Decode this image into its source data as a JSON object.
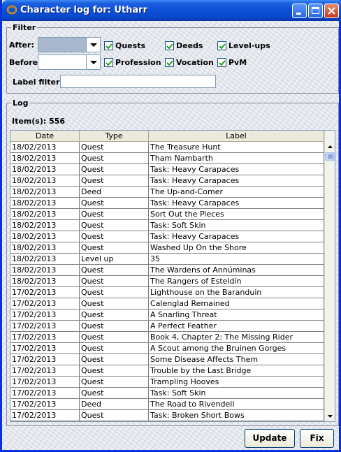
{
  "window": {
    "title": "Character log for: Utharr"
  },
  "filter": {
    "group_title": "Filter",
    "after_label": "After:",
    "before_label": "Before:",
    "label_filter_label": "Label filter:",
    "label_filter_value": "",
    "checkboxes": [
      {
        "label": "Quests",
        "checked": true
      },
      {
        "label": "Deeds",
        "checked": true
      },
      {
        "label": "Level-ups",
        "checked": true
      },
      {
        "label": "Profession",
        "checked": true
      },
      {
        "label": "Vocation",
        "checked": true
      },
      {
        "label": "PvM",
        "checked": true
      }
    ]
  },
  "log": {
    "group_title": "Log",
    "item_count": "Item(s): 556",
    "columns": [
      "Date",
      "Type",
      "Label"
    ],
    "rows": [
      [
        "18/02/2013",
        "Quest",
        "The Treasure Hunt"
      ],
      [
        "18/02/2013",
        "Quest",
        "Tham Nambarth"
      ],
      [
        "18/02/2013",
        "Quest",
        "Task: Heavy Carapaces"
      ],
      [
        "18/02/2013",
        "Quest",
        "Task: Heavy Carapaces"
      ],
      [
        "18/02/2013",
        "Deed",
        "The Up-and-Comer"
      ],
      [
        "18/02/2013",
        "Quest",
        "Task: Heavy Carapaces"
      ],
      [
        "18/02/2013",
        "Quest",
        "Sort Out the Pieces"
      ],
      [
        "18/02/2013",
        "Quest",
        "Task: Soft Skin"
      ],
      [
        "18/02/2013",
        "Quest",
        "Task: Heavy Carapaces"
      ],
      [
        "18/02/2013",
        "Quest",
        "Washed Up On the Shore"
      ],
      [
        "18/02/2013",
        "Level up",
        "35"
      ],
      [
        "18/02/2013",
        "Quest",
        "The Wardens of Annúminas"
      ],
      [
        "18/02/2013",
        "Quest",
        "The Rangers of Esteldín"
      ],
      [
        "17/02/2013",
        "Quest",
        "Lighthouse on the Baranduin"
      ],
      [
        "17/02/2013",
        "Quest",
        "Calenglad Remained"
      ],
      [
        "17/02/2013",
        "Quest",
        "A Snarling Threat"
      ],
      [
        "17/02/2013",
        "Quest",
        "A Perfect Feather"
      ],
      [
        "17/02/2013",
        "Quest",
        "Book 4, Chapter 2: The Missing Rider"
      ],
      [
        "17/02/2013",
        "Quest",
        "A Scout among the Bruinen Gorges"
      ],
      [
        "17/02/2013",
        "Quest",
        "Some Disease Affects Them"
      ],
      [
        "17/02/2013",
        "Quest",
        "Trouble by the Last Bridge"
      ],
      [
        "17/02/2013",
        "Quest",
        "Trampling Hooves"
      ],
      [
        "17/02/2013",
        "Quest",
        "Task: Soft Skin"
      ],
      [
        "17/02/2013",
        "Deed",
        "The Road to Rivendell"
      ],
      [
        "17/02/2013",
        "Quest",
        "Task: Broken Short Bows"
      ]
    ]
  },
  "buttons": {
    "update": "Update",
    "fix": "Fix"
  }
}
